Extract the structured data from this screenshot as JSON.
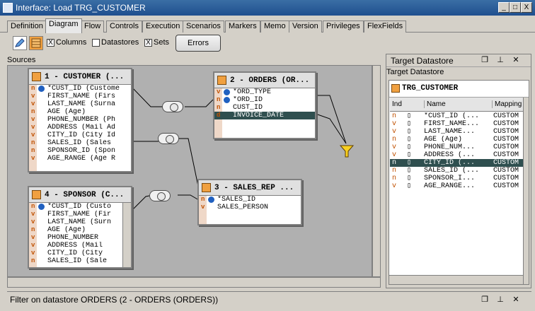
{
  "window": {
    "title": "Interface: Load TRG_CUSTOMER",
    "buttons": [
      "_",
      "□",
      "X"
    ]
  },
  "tabs": [
    "Definition",
    "Diagram",
    "Flow",
    "Controls",
    "Execution",
    "Scenarios",
    "Markers",
    "Memo",
    "Version",
    "Privileges",
    "FlexFields"
  ],
  "active_tab": "Diagram",
  "toolbar": {
    "columns_label": "Columns",
    "datastores_label": "Datastores",
    "sets_label": "Sets",
    "errors_label": "Errors",
    "columns_checked": "X",
    "sets_checked": "X"
  },
  "sources_label": "Sources",
  "customer": {
    "title": "1 - CUSTOMER (...",
    "rows": [
      {
        "ind": "n",
        "key": true,
        "text": "*CUST_ID (Custome"
      },
      {
        "ind": "v",
        "key": false,
        "text": "FIRST_NAME (Firs"
      },
      {
        "ind": "v",
        "key": false,
        "text": "LAST_NAME (Surna"
      },
      {
        "ind": "n",
        "key": false,
        "text": "AGE (Age)"
      },
      {
        "ind": "v",
        "key": false,
        "text": "PHONE_NUMBER (Ph"
      },
      {
        "ind": "v",
        "key": false,
        "text": "ADDRESS (Mail Ad"
      },
      {
        "ind": "v",
        "key": false,
        "text": "CITY_ID (City Id"
      },
      {
        "ind": "n",
        "key": false,
        "text": "SALES_ID (Sales"
      },
      {
        "ind": "n",
        "key": false,
        "text": "SPONSOR_ID (Spon"
      },
      {
        "ind": "v",
        "key": false,
        "text": "AGE_RANGE (Age R"
      }
    ]
  },
  "orders": {
    "title": "2 - ORDERS (OR...",
    "rows": [
      {
        "ind": "v",
        "key": true,
        "text": "*ORD_TYPE"
      },
      {
        "ind": "n",
        "key": true,
        "text": "*ORD_ID"
      },
      {
        "ind": "n",
        "key": false,
        "text": "CUST_ID"
      },
      {
        "ind": "d",
        "key": false,
        "text": "INVOICE_DATE"
      }
    ]
  },
  "sponsor": {
    "title": "4 - SPONSOR (C...",
    "rows": [
      {
        "ind": "n",
        "key": true,
        "text": "*CUST_ID (Custo"
      },
      {
        "ind": "v",
        "key": false,
        "text": "FIRST_NAME (Fir"
      },
      {
        "ind": "v",
        "key": false,
        "text": "LAST_NAME (Surn"
      },
      {
        "ind": "n",
        "key": false,
        "text": "AGE (Age)"
      },
      {
        "ind": "v",
        "key": false,
        "text": "PHONE_NUMBER"
      },
      {
        "ind": "v",
        "key": false,
        "text": "ADDRESS (Mail"
      },
      {
        "ind": "v",
        "key": false,
        "text": "CITY_ID (City"
      },
      {
        "ind": "n",
        "key": false,
        "text": "SALES_ID (Sale"
      }
    ]
  },
  "sales_rep": {
    "title": "3 - SALES_REP ...",
    "rows": [
      {
        "ind": "n",
        "key": true,
        "text": "*SALES_ID"
      },
      {
        "ind": "v",
        "key": false,
        "text": "SALES_PERSON"
      }
    ]
  },
  "target": {
    "panel_title": "Target Datastore",
    "subtitle": "Target Datastore",
    "table_name": "TRG_CUSTOMER",
    "headers": {
      "ind": "Ind",
      "name": "Name",
      "mapping": "Mapping"
    },
    "rows": [
      {
        "ind": "n",
        "name": "*CUST_ID (...",
        "mapping": "CUSTOM"
      },
      {
        "ind": "v",
        "name": "FIRST_NAME...",
        "mapping": "CUSTOM"
      },
      {
        "ind": "v",
        "name": "LAST_NAME...",
        "mapping": "CUSTOM"
      },
      {
        "ind": "n",
        "name": "AGE (Age)",
        "mapping": "CUSTOM"
      },
      {
        "ind": "v",
        "name": "PHONE_NUM...",
        "mapping": "CUSTOM"
      },
      {
        "ind": "v",
        "name": "ADDRESS (...",
        "mapping": "CUSTOM"
      },
      {
        "ind": "n",
        "name": "CITY_ID (...",
        "mapping": "CUSTOM"
      },
      {
        "ind": "n",
        "name": "SALES_ID (...",
        "mapping": "CUSTOM"
      },
      {
        "ind": "n",
        "name": "SPONSOR_I...",
        "mapping": "CUSTOM"
      },
      {
        "ind": "v",
        "name": "AGE_RANGE...",
        "mapping": "CUSTOM"
      }
    ]
  },
  "bottom_panel": {
    "label": "Filter on datastore ORDERS (2 - ORDERS (ORDERS))"
  },
  "colors": {
    "selected_row": "#2f4f4f",
    "title_bar": "#1f4f8f",
    "canvas": "#b0b0b0"
  }
}
